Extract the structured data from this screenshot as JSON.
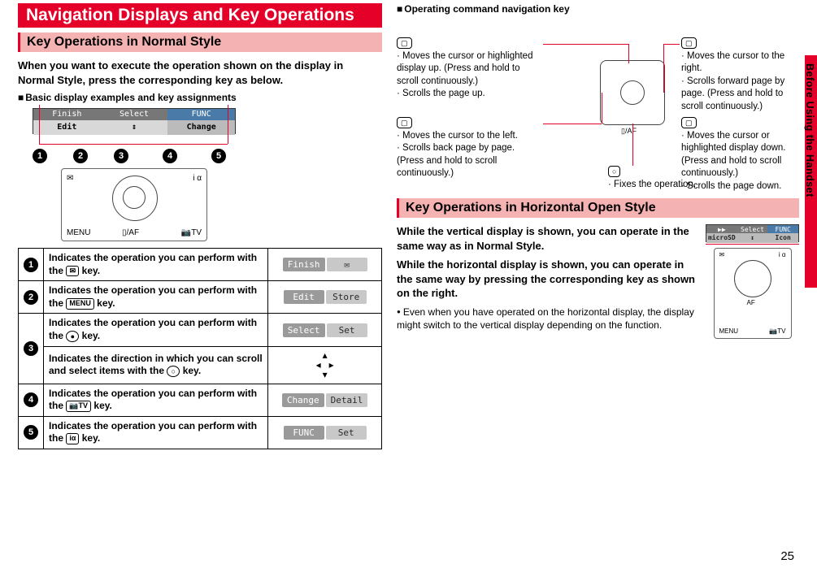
{
  "side_tab": "Before Using the Handset",
  "page_number": "25",
  "main_title": "Navigation Displays and Key Operations",
  "sub_title_1": "Key Operations in Normal Style",
  "intro_1": "When you want to execute the operation shown on the display in Normal Style, press the corresponding key as below.",
  "basic_head": "Basic display examples and key assignments",
  "disp": {
    "l_top": "Finish",
    "l_bot": "Edit",
    "c_top": "Select",
    "c_bot": "↕",
    "r_top": "FUNC",
    "r_bot": "Change"
  },
  "keypad": {
    "menu": "MENU",
    "af": "▯/AF",
    "tv": "📷TV",
    "mail": "✉"
  },
  "ops": [
    {
      "num": "1",
      "desc_a": "Indicates the operation you can perform with the ",
      "key": "✉",
      "desc_b": " key.",
      "btn1": "Finish",
      "btn2": "✉"
    },
    {
      "num": "2",
      "desc_a": "Indicates the operation you can perform with the ",
      "key": "MENU",
      "desc_b": " key.",
      "btn1": "Edit",
      "btn2": "Store"
    },
    {
      "num": "3a",
      "desc_a": "Indicates the operation you can perform with the ",
      "key": "●",
      "desc_b": " key.",
      "btn1": "Select",
      "btn2": "Set"
    },
    {
      "num": "3b",
      "desc_a": "Indicates the direction in which you can scroll and select items with the ",
      "key": "○",
      "desc_b": " key.",
      "arrows": true
    },
    {
      "num": "4",
      "desc_a": "Indicates the operation you can perform with the ",
      "key": "📷TV",
      "desc_b": " key.",
      "btn1": "Change",
      "btn2": "Detail"
    },
    {
      "num": "5",
      "desc_a": "Indicates the operation you can perform with the ",
      "key": "iα",
      "desc_b": " key.",
      "btn1": "FUNC",
      "btn2": "Set"
    }
  ],
  "nav_head": "Operating command navigation key",
  "nav": {
    "up": {
      "l1": "Moves the cursor or highlighted display up. (Press and hold to scroll continuously.)",
      "l2": "Scrolls the page up."
    },
    "left": {
      "l1": "Moves the cursor to the left.",
      "l2": "Scrolls back page by page. (Press and hold to scroll continuously.)"
    },
    "right": {
      "l1": "Moves the cursor to the right.",
      "l2": "Scrolls forward page by page. (Press and hold to scroll continuously.)"
    },
    "down": {
      "l1": "Moves the cursor or highlighted display down. (Press and hold to scroll continuously.)",
      "l2": "Scrolls the page down."
    },
    "center": "Fixes the operation."
  },
  "sub_title_2": "Key Operations in Horizontal Open Style",
  "hor_text_1": "While the vertical display is shown, you can operate in the same way as in Normal Style.",
  "hor_text_2": "While the horizontal display is shown, you can operate in the same way by pressing the corresponding key as shown on the right.",
  "hor_note": "Even when you have operated on the horizontal display, the display might switch to the vertical display depending on the function.",
  "hor_disp": {
    "l_top": "▶▶",
    "l_bot": "microSD",
    "c_top": "Select",
    "c_bot": "↕",
    "r_top": "FUNC",
    "r_bot": "Icon"
  },
  "hor_keypad": {
    "mail": "✉",
    "i": "i α",
    "af": "AF",
    "menu": "MENU",
    "tv": "📷TV"
  }
}
